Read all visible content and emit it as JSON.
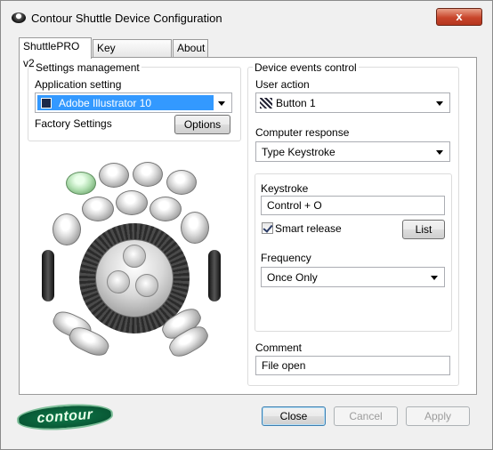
{
  "window": {
    "title": "Contour Shuttle Device Configuration",
    "close_glyph": "x"
  },
  "tabs": [
    {
      "label": "ShuttlePRO v2",
      "active": true
    },
    {
      "label": "Key Composer™",
      "active": false
    },
    {
      "label": "About",
      "active": false
    }
  ],
  "settings": {
    "group_title": "Settings management",
    "app_setting_label": "Application setting",
    "app_setting_value": "Adobe Illustrator 10",
    "factory_label": "Factory Settings",
    "options_button": "Options"
  },
  "device_events": {
    "group_title": "Device events control",
    "user_action_label": "User action",
    "user_action_value": "Button 1",
    "computer_response_label": "Computer response",
    "computer_response_value": "Type Keystroke",
    "keystroke_label": "Keystroke",
    "keystroke_value": "Control + O",
    "smart_release_label": "Smart release",
    "smart_release_checked": true,
    "list_button": "List",
    "frequency_label": "Frequency",
    "frequency_value": "Once Only",
    "comment_label": "Comment",
    "comment_value": "File open"
  },
  "device_image": {
    "selected_button": "Button 1",
    "selected_color": "#b3e0b3"
  },
  "footer": {
    "logo_text": "contour",
    "close_button": "Close",
    "cancel_button": "Cancel",
    "apply_button": "Apply"
  },
  "colors": {
    "selection": "#3399ff",
    "close_button": "#c8452b"
  }
}
